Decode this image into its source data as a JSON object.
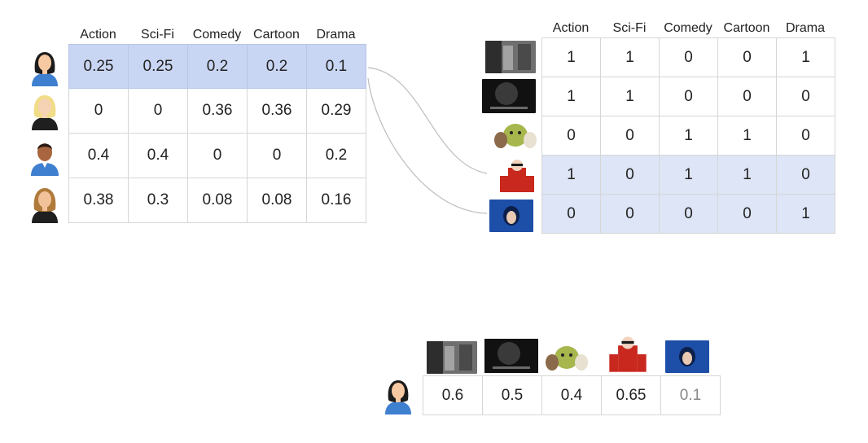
{
  "genres": [
    "Action",
    "Sci-Fi",
    "Comedy",
    "Cartoon",
    "Drama"
  ],
  "user_matrix": [
    [
      "0.25",
      "0.25",
      "0.2",
      "0.2",
      "0.1"
    ],
    [
      "0",
      "0",
      "0.36",
      "0.36",
      "0.29"
    ],
    [
      "0.4",
      "0.4",
      "0",
      "0",
      "0.2"
    ],
    [
      "0.38",
      "0.3",
      "0.08",
      "0.08",
      "0.16"
    ]
  ],
  "movie_matrix": [
    [
      "1",
      "1",
      "0",
      "0",
      "1"
    ],
    [
      "1",
      "1",
      "0",
      "0",
      "0"
    ],
    [
      "0",
      "0",
      "1",
      "1",
      "0"
    ],
    [
      "1",
      "0",
      "1",
      "1",
      "0"
    ],
    [
      "0",
      "0",
      "0",
      "0",
      "1"
    ]
  ],
  "scores": [
    "0.6",
    "0.5",
    "0.4",
    "0.65",
    "0.1"
  ],
  "users": [
    {
      "icon": "woman-dark-hair-avatar-icon",
      "shirt": "#3f7fd0",
      "hair": "#1b1b1b",
      "skin": "#f7c9a3"
    },
    {
      "icon": "woman-blonde-avatar-icon",
      "shirt": "#1f1f1f",
      "hair": "#f1dc88",
      "skin": "#f7d3b5"
    },
    {
      "icon": "man-avatar-icon",
      "shirt": "#3f7fd0",
      "hair": "#2a1a12",
      "skin": "#a8653f"
    },
    {
      "icon": "woman-brown-hair-avatar-icon",
      "shirt": "#1f1f1f",
      "hair": "#b07a3a",
      "skin": "#f2c39b"
    }
  ],
  "movies": [
    {
      "icon": "action-movie-poster-thumbnail",
      "colors": [
        "#6f6f6f",
        "#2d2d2d",
        "#a3a3a3"
      ]
    },
    {
      "icon": "dark-scifi-movie-poster-thumbnail",
      "colors": [
        "#3a3a3a",
        "#111111",
        "#6a6a6a"
      ]
    },
    {
      "icon": "animated-ogre-movie-poster-thumbnail",
      "colors": [
        "#a7b64d",
        "#6e8a2a",
        "#e8e0d0"
      ]
    },
    {
      "icon": "animated-superhero-movie-poster-thumbnail",
      "colors": [
        "#c8281e",
        "#1a1a1a",
        "#f2d3c0"
      ]
    },
    {
      "icon": "drama-movie-poster-thumbnail",
      "colors": [
        "#1d4fa8",
        "#0c1f4a",
        "#e9c9b2"
      ]
    }
  ],
  "colors": {
    "highlight_user_row": "#c9d6f3",
    "highlight_movie_rows": "#dde5f6",
    "connector": "#bdbdbd",
    "faded_score": "#888888"
  }
}
